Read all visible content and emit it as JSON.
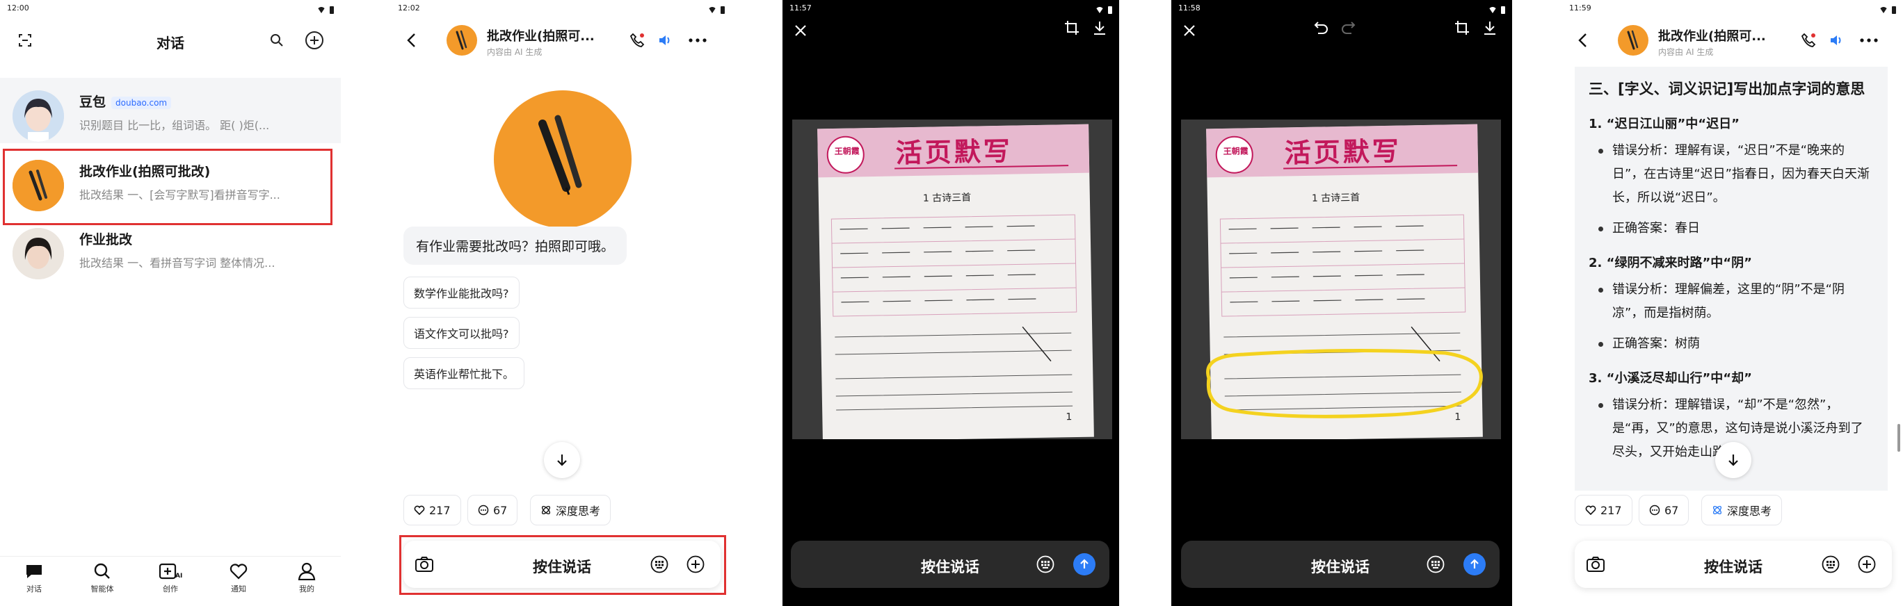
{
  "screen1": {
    "time": "12:00",
    "title": "对话",
    "chats": [
      {
        "name": "豆包",
        "badge": "doubao.com",
        "preview": "识别题目 比一比，组词语。 距(  )炬(..."
      },
      {
        "name": "批改作业(拍照可批改)",
        "preview": "批改结果 一、[会写字默写]看拼音写字..."
      },
      {
        "name": "作业批改",
        "preview": "批改结果 一、看拼音写字词 整体情况..."
      }
    ],
    "nav": [
      "对话",
      "智能体",
      "创作",
      "通知",
      "我的"
    ]
  },
  "screen2": {
    "time": "12:02",
    "bot_name": "批改作业(拍照可...",
    "bot_sub": "内容由 AI 生成",
    "greeting": "有作业需要批改吗？拍照即可哦。",
    "suggestions": [
      "数学作业能批改吗?",
      "语文作文可以批吗?",
      "英语作业帮忙批下。"
    ],
    "likes": "217",
    "comments": "67",
    "deep_think": "深度思考",
    "talk_label": "按住说话"
  },
  "screen3": {
    "time": "11:57",
    "paper_brand": "王朝霞",
    "paper_title": "活页默写",
    "paper_lesson": "1 古诗三首",
    "talk_label": "按住说话"
  },
  "screen4": {
    "time": "11:58",
    "paper_brand": "王朝霞",
    "paper_title": "活页默写",
    "paper_lesson": "1 古诗三首",
    "talk_label": "按住说话"
  },
  "screen5": {
    "time": "11:59",
    "bot_name": "批改作业(拍照可...",
    "bot_sub": "内容由 AI 生成",
    "heading": "三、[字义、词义识记]写出加点字词的意思",
    "items": [
      {
        "title": "1. “迟日江山丽”中“迟日”",
        "bullets": [
          "错误分析：理解有误，“迟日”不是“晚来的日”，在古诗里“迟日”指春日，因为春天白天渐长，所以说“迟日”。",
          "正确答案：春日"
        ]
      },
      {
        "title": "2. “绿阴不减来时路”中“阴”",
        "bullets": [
          "错误分析：理解偏差，这里的“阴”不是“阴凉”，而是指树荫。",
          "正确答案：树荫"
        ]
      },
      {
        "title": "3. “小溪泛尽却山行”中“却”",
        "bullets": [
          "错误分析：理解错误，“却”不是“忽然”，是“再，又”的意思，这句诗是说小溪泛舟到了尽头，又开始走山路。"
        ]
      }
    ],
    "likes": "217",
    "comments": "67",
    "deep_think": "深度思考",
    "talk_label": "按住说话"
  },
  "colors": {
    "accent": "#2c7cf6",
    "highlight": "#e03131",
    "bot_orange": "#f39a2a",
    "paper_pink": "#c2185b"
  }
}
